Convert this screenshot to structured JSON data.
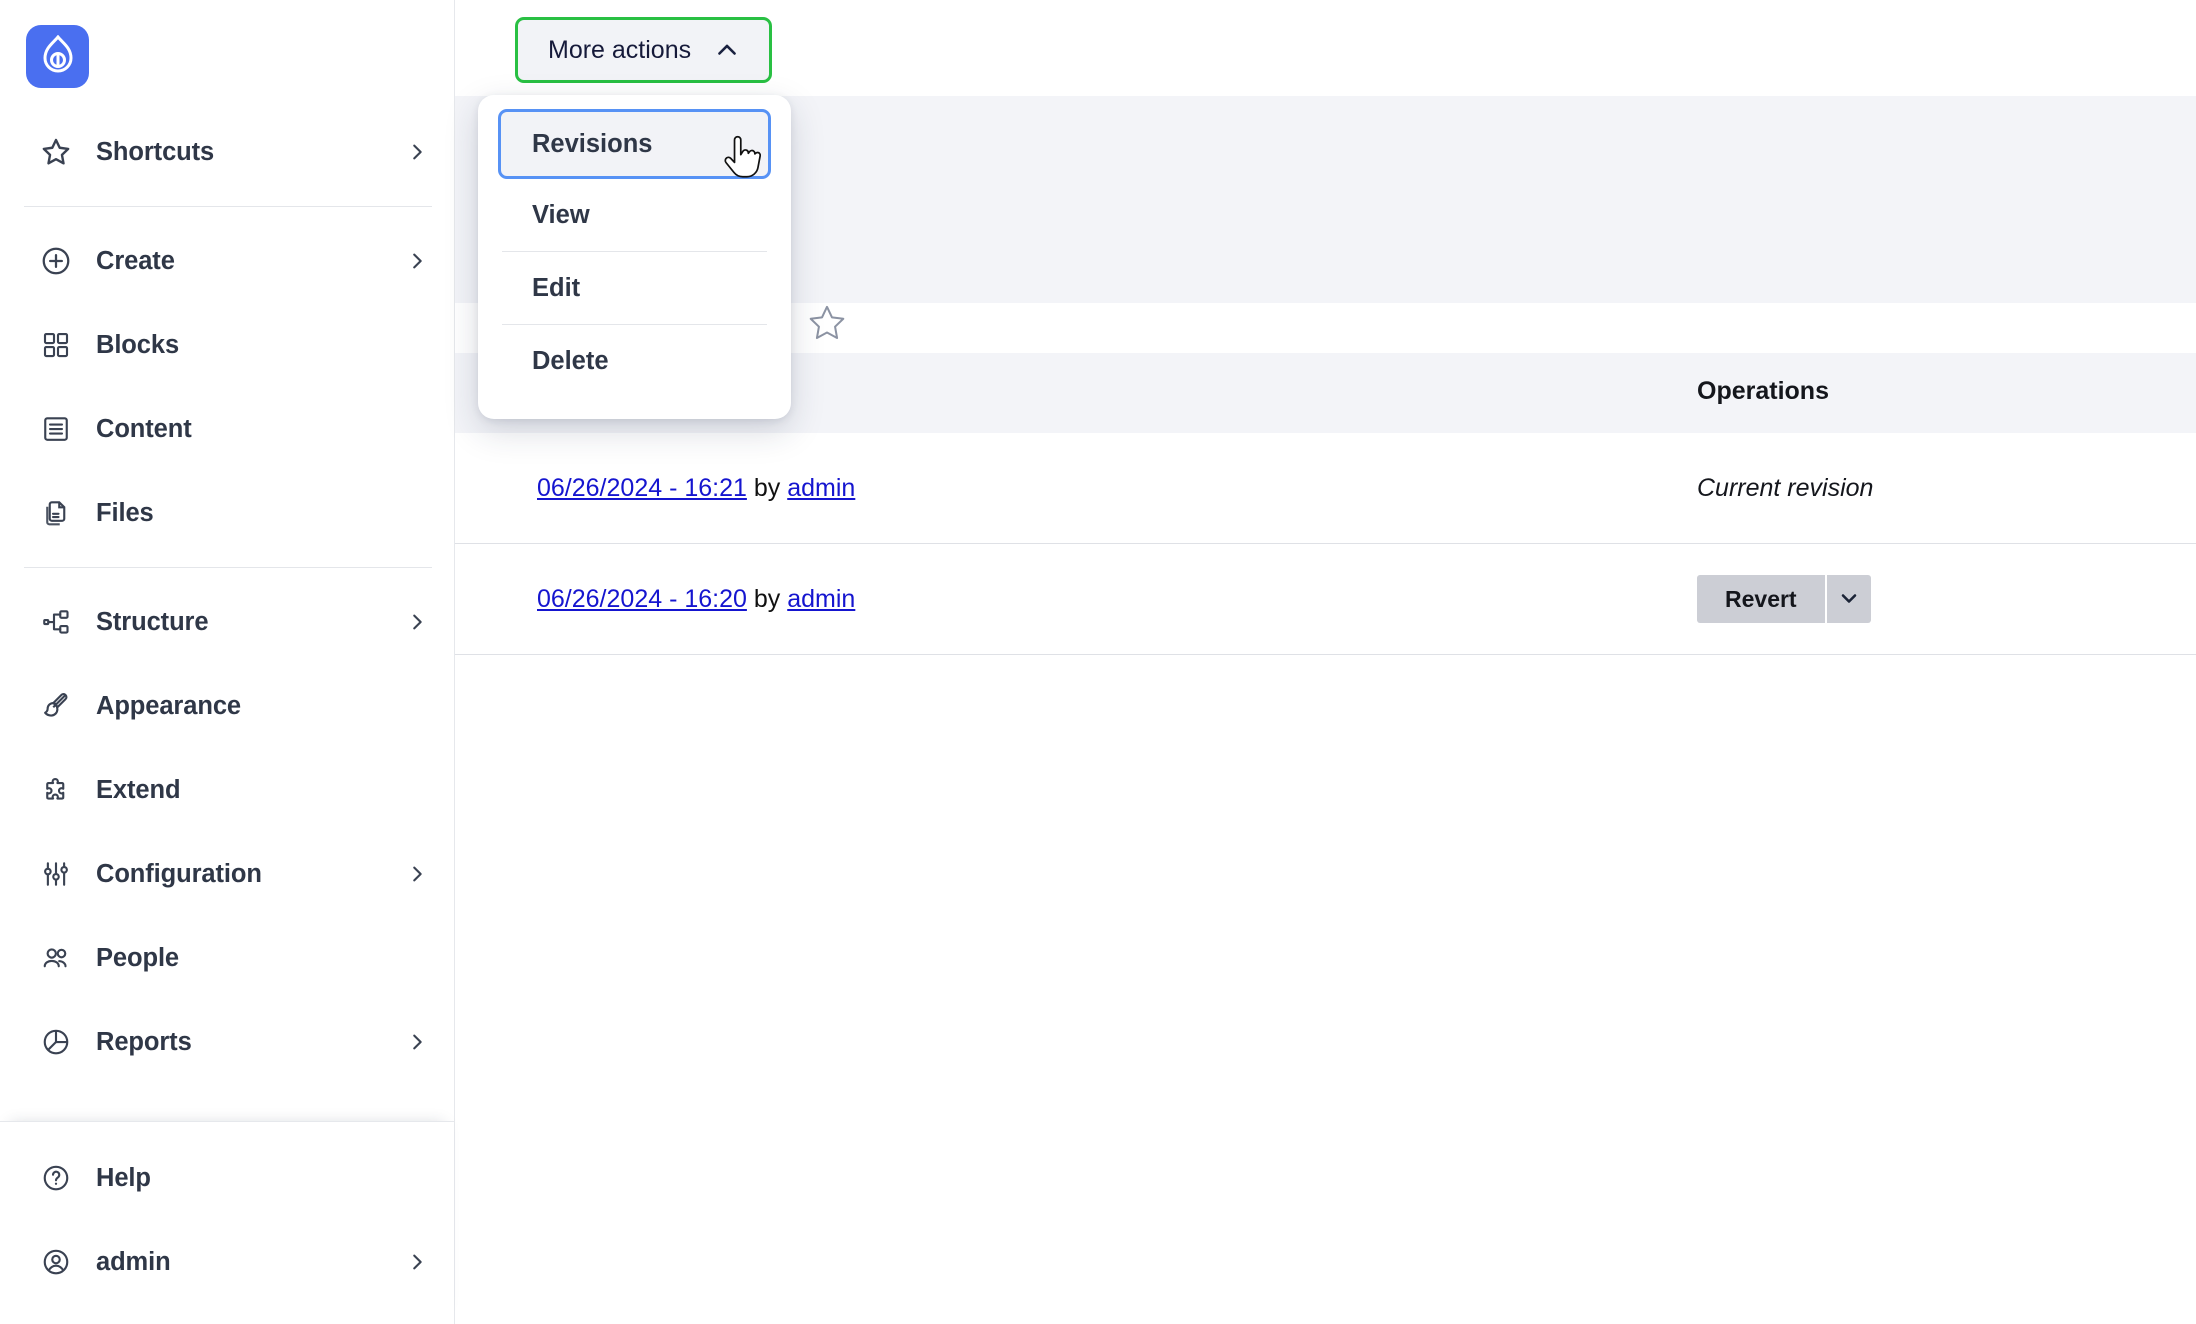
{
  "app": {
    "logo_icon": "drupal-drop-icon",
    "brand_color": "#4a6ff0"
  },
  "sidebar": {
    "groups": [
      {
        "items": [
          {
            "label": "Shortcuts",
            "icon": "star-icon",
            "has_chevron": true
          }
        ]
      },
      {
        "items": [
          {
            "label": "Create",
            "icon": "plus-circle-icon",
            "has_chevron": true
          },
          {
            "label": "Blocks",
            "icon": "blocks-grid-icon",
            "has_chevron": false
          },
          {
            "label": "Content",
            "icon": "content-document-icon",
            "has_chevron": false
          },
          {
            "label": "Files",
            "icon": "files-copy-icon",
            "has_chevron": false
          }
        ]
      },
      {
        "items": [
          {
            "label": "Structure",
            "icon": "structure-sitemap-icon",
            "has_chevron": true
          },
          {
            "label": "Appearance",
            "icon": "appearance-brush-icon",
            "has_chevron": false
          },
          {
            "label": "Extend",
            "icon": "extend-puzzle-icon",
            "has_chevron": false
          },
          {
            "label": "Configuration",
            "icon": "configuration-sliders-icon",
            "has_chevron": true
          },
          {
            "label": "People",
            "icon": "people-users-icon",
            "has_chevron": false
          },
          {
            "label": "Reports",
            "icon": "reports-pie-chart-icon",
            "has_chevron": true
          }
        ]
      }
    ],
    "bottom_items": [
      {
        "label": "Help",
        "icon": "help-question-circle-icon",
        "has_chevron": false
      },
      {
        "label": "admin",
        "icon": "user-account-circle-icon",
        "has_chevron": true
      }
    ]
  },
  "toolbar": {
    "more_actions_label": "More actions",
    "more_actions_icon": "chevron-up-icon",
    "more_actions_border_color": "#29c043"
  },
  "dropdown": {
    "items": [
      {
        "label": "Revisions",
        "selected": true,
        "separator_after": false
      },
      {
        "label": "View",
        "selected": false,
        "separator_after": true
      },
      {
        "label": "Edit",
        "selected": false,
        "separator_after": true
      },
      {
        "label": "Delete",
        "selected": false,
        "separator_after": false
      }
    ],
    "selected_border_color": "#5792f5"
  },
  "page_header": {
    "star_icon": "star-outline-icon"
  },
  "revisions_table": {
    "columns": [
      {
        "key": "revision",
        "label": ""
      },
      {
        "key": "operations",
        "label": "Operations"
      }
    ],
    "rows": [
      {
        "date_link": "06/26/2024 - 16:21",
        "by_text": "by",
        "author_link": "admin",
        "operation_type": "text",
        "operation_text": "Current revision"
      },
      {
        "date_link": "06/26/2024 - 16:20",
        "by_text": "by",
        "author_link": "admin",
        "operation_type": "split-button",
        "operation_button_label": "Revert",
        "operation_button_icon": "chevron-down-icon"
      }
    ]
  },
  "cursor": {
    "icon": "pointing-hand-cursor"
  }
}
